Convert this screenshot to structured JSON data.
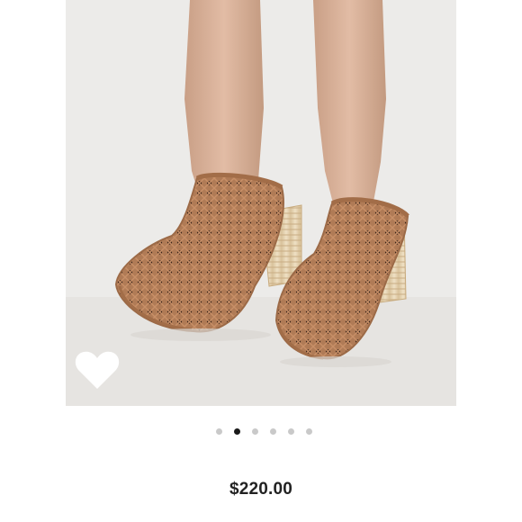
{
  "listing": {
    "price": "$220.00",
    "photo": {
      "subject": "woven-leather-mule-heels",
      "background_color": "#ecebe9"
    },
    "favorite": {
      "icon": "heart-icon",
      "color": "#ffffff"
    },
    "carousel": {
      "total_pages": 6,
      "current_page": 2,
      "active_color": "#1a1a1a",
      "inactive_color": "#c9c9c9"
    }
  }
}
